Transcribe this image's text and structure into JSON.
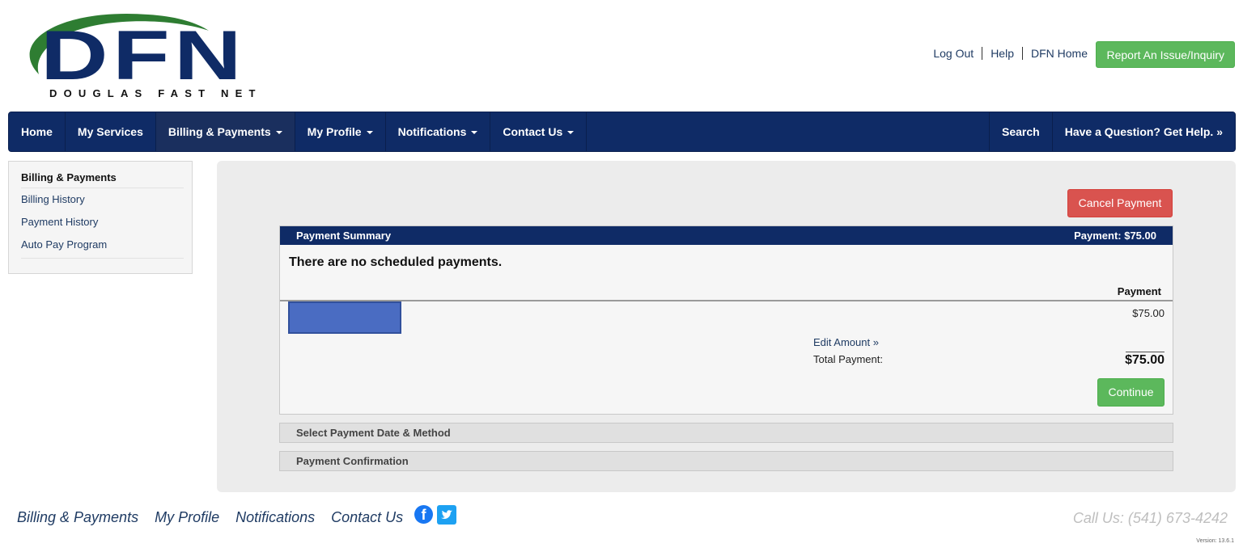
{
  "brand": {
    "logo_text": "DFN",
    "tagline": "DOUGLAS FAST NET",
    "colors": {
      "navy": "#0f2b66",
      "green": "#2e7d32"
    }
  },
  "header": {
    "links": [
      "Log Out",
      "Help",
      "DFN Home"
    ],
    "report_button": "Report An Issue/Inquiry"
  },
  "nav": {
    "left": [
      {
        "label": "Home",
        "dropdown": false
      },
      {
        "label": "My Services",
        "dropdown": false
      },
      {
        "label": "Billing & Payments",
        "dropdown": true,
        "active": true
      },
      {
        "label": "My Profile",
        "dropdown": true
      },
      {
        "label": "Notifications",
        "dropdown": true
      },
      {
        "label": "Contact Us",
        "dropdown": true
      }
    ],
    "right": [
      {
        "label": "Search"
      },
      {
        "label": "Have a Question? Get Help. »"
      }
    ]
  },
  "sidebar": {
    "title": "Billing & Payments",
    "items": [
      "Billing History",
      "Payment History",
      "Auto Pay Program"
    ]
  },
  "main": {
    "cancel_button": "Cancel Payment",
    "summary": {
      "title": "Payment Summary",
      "payment_total_header": "Payment: $75.00",
      "no_scheduled": "There are no scheduled payments.",
      "column_header": "Payment",
      "amount": "$75.00",
      "edit_amount": "Edit Amount »",
      "total_label": "Total Payment:",
      "total_value": "$75.00",
      "continue_button": "Continue"
    },
    "steps": [
      "Select Payment Date & Method",
      "Payment Confirmation"
    ]
  },
  "footer": {
    "links": [
      "Billing & Payments",
      "My Profile",
      "Notifications",
      "Contact Us"
    ],
    "social_icons": [
      "facebook-icon",
      "twitter-icon"
    ],
    "call_us": "Call Us: (541) 673-4242",
    "version": "Version: 13.6.1"
  }
}
